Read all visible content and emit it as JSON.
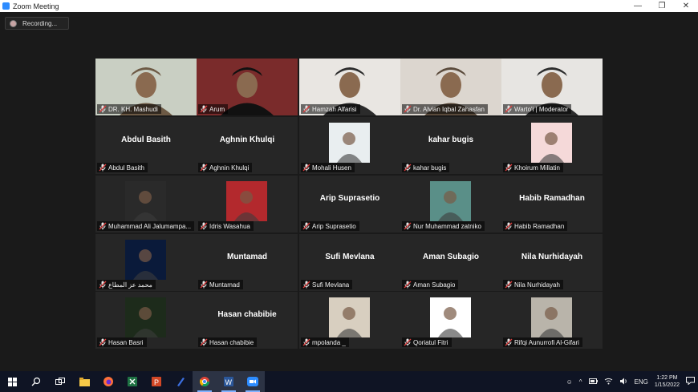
{
  "window": {
    "title": "Zoom Meeting"
  },
  "recording": {
    "label": "Recording..."
  },
  "participants": [
    {
      "name": "DR. KH. Mashudi",
      "video": true,
      "active": true
    },
    {
      "name": "Arum",
      "video": true
    },
    {
      "name": "Hamzah Alfarisi",
      "video": true
    },
    {
      "name": "Dr. Alvian Iqbal Zahasfan",
      "video": true
    },
    {
      "name": "Warto'i | Moderator",
      "video": true
    },
    {
      "name": "Abdul Basith",
      "display": "Abdul Basith"
    },
    {
      "name": "Aghnin Khulqi",
      "display": "Aghnin Khulqi"
    },
    {
      "name": "Mohali Husen",
      "thumb": true
    },
    {
      "name": "kahar bugis",
      "display": "kahar bugis"
    },
    {
      "name": "Khoirum Millatin",
      "thumb": true
    },
    {
      "name": "Muhammad Ali Jalumampa...",
      "thumb": true
    },
    {
      "name": "Idris Wasahua",
      "thumb": true
    },
    {
      "name": "Arip Suprasetio",
      "display": "Arip Suprasetio"
    },
    {
      "name": "Nur Muhammad zatniko",
      "thumb": true
    },
    {
      "name": "Habib Ramadhan",
      "display": "Habib Ramadhan"
    },
    {
      "name": "محمد عز المطاع",
      "thumb": true
    },
    {
      "name": "Muntamad",
      "display": "Muntamad"
    },
    {
      "name": "Sufi Mevlana",
      "display": "Sufi Mevlana"
    },
    {
      "name": "Aman Subagio",
      "display": "Aman Subagio"
    },
    {
      "name": "Nila Nurhidayah",
      "display": "Nila Nurhidayah"
    },
    {
      "name": "Hasan Basri",
      "thumb": true
    },
    {
      "name": "Hasan chabibie",
      "display": "Hasan chabibie"
    },
    {
      "name": "mpolanda _",
      "thumb": true
    },
    {
      "name": "Qoriatul Fitri",
      "thumb": true
    },
    {
      "name": "Rifqi Aunurrofi Al-Gifari",
      "thumb": true
    }
  ],
  "taskbar": {
    "lang": "ENG",
    "time": "1:22 PM",
    "date": "1/15/2022"
  },
  "colors": {
    "active_speaker": "#d6e03c",
    "tile_bg": "#262626",
    "taskbar": "#0f1424"
  }
}
